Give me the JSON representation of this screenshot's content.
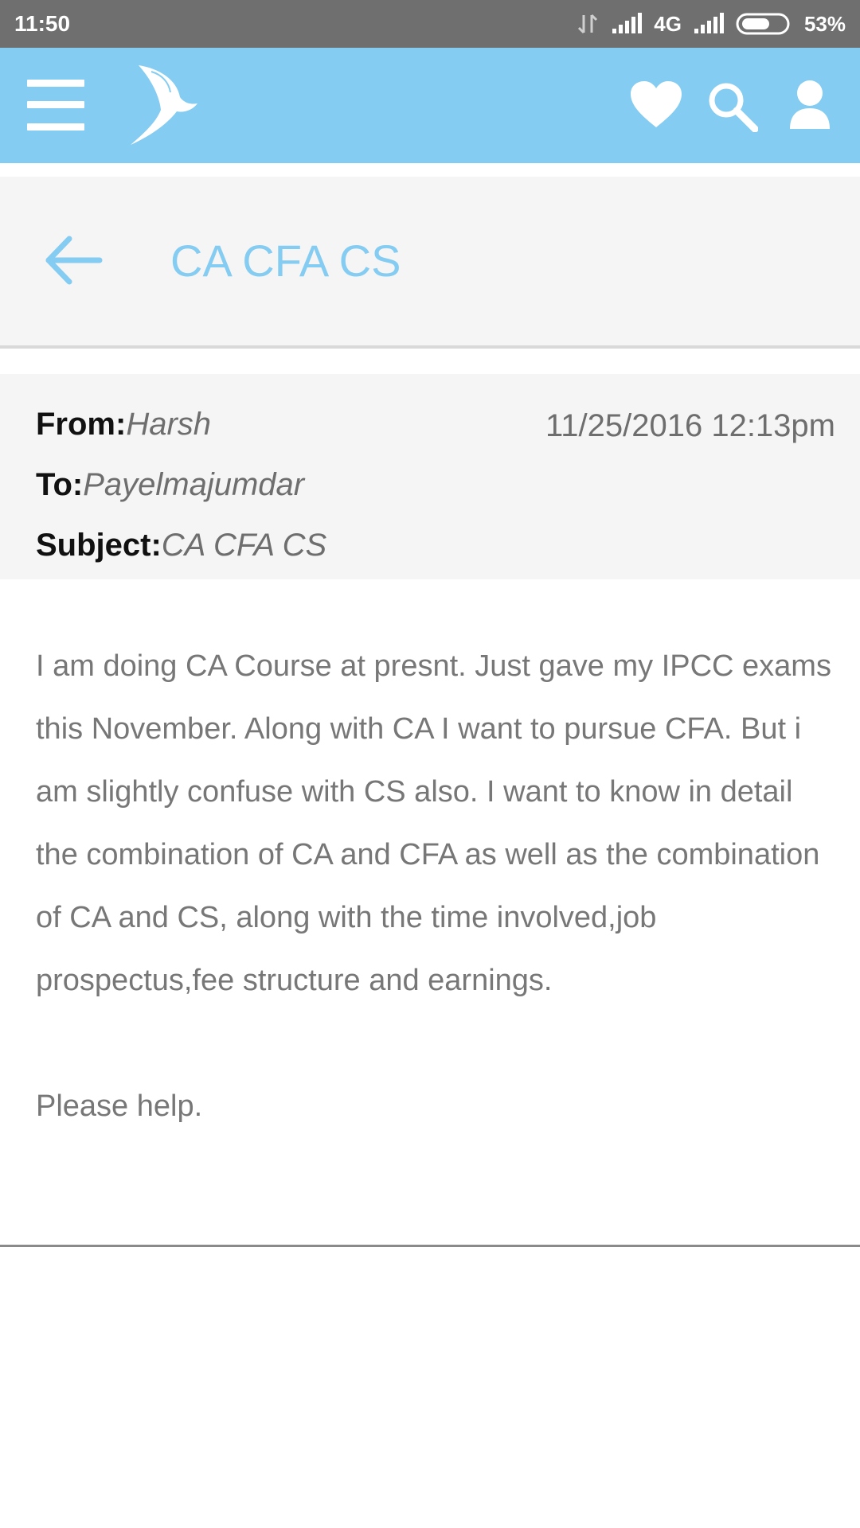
{
  "status_bar": {
    "time": "11:50",
    "network": "4G",
    "battery": "53%"
  },
  "app_bar": {
    "icons": [
      "menu-icon",
      "bird-logo-icon",
      "heart-icon",
      "search-icon",
      "profile-icon"
    ]
  },
  "title_panel": {
    "title": "CA CFA CS"
  },
  "message": {
    "from_label": "From:",
    "from": "Harsh",
    "to_label": "To:",
    "to": "Payelmajumdar",
    "subject_label": "Subject:",
    "subject": "CA CFA CS",
    "date": "11/25/2016 12:13pm",
    "body": "I am doing CA Course at presnt. Just gave my IPCC exams this November. Along with CA I want to pursue CFA. But i am slightly confuse with CS also. I want to know in detail the combination of CA and CFA as well as the combination of CA and CS, along with the time involved,job prospectus,fee structure and earnings.",
    "closing": "Please help."
  },
  "colors": {
    "accent": "#84ccf1",
    "status_bar": "#6f6f6f",
    "panel_bg": "#f5f5f5"
  }
}
